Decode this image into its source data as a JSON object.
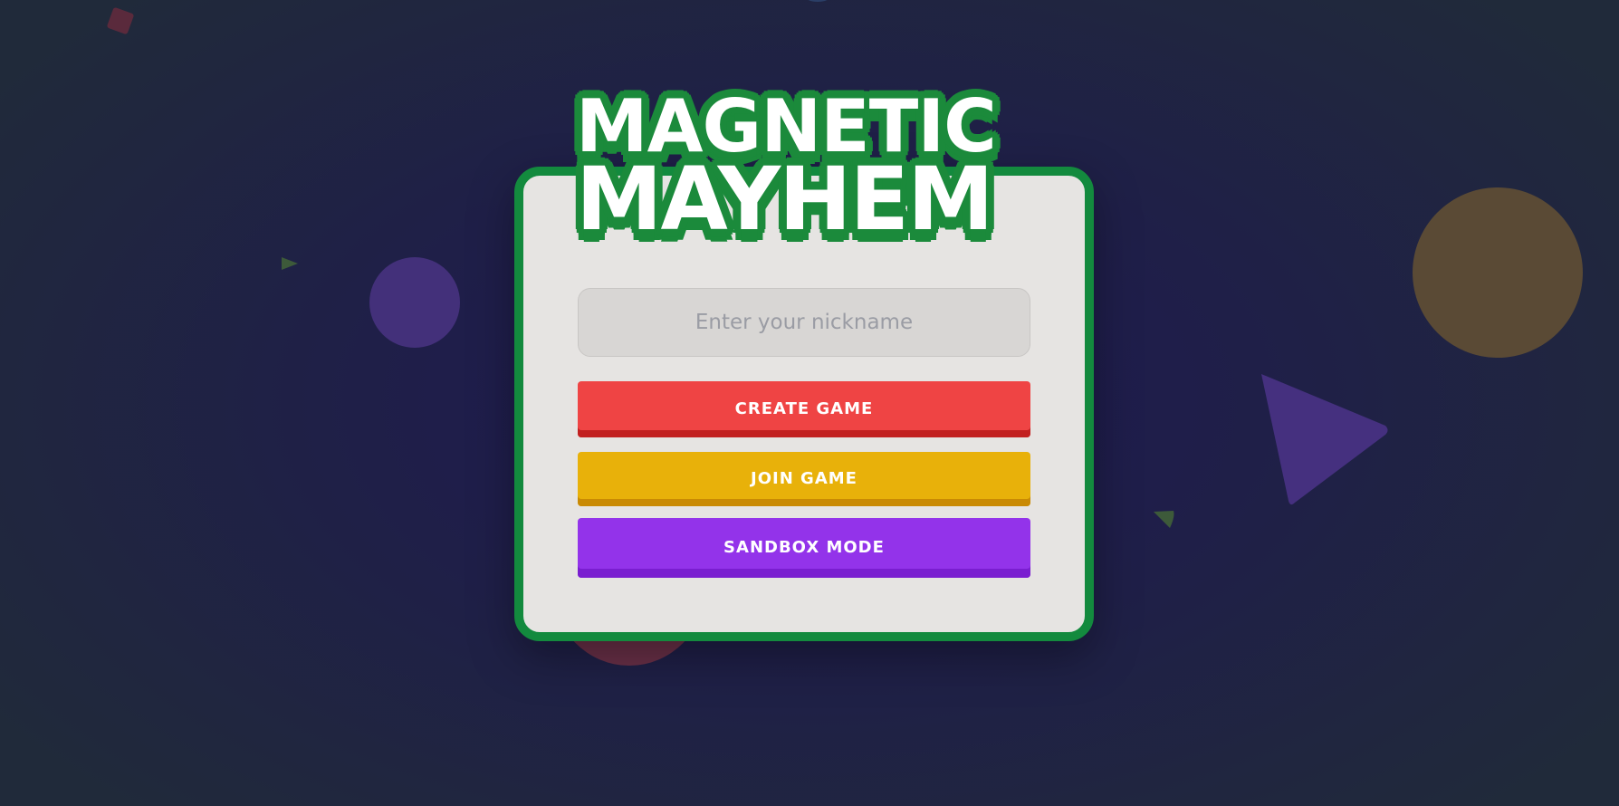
{
  "logo": {
    "line1": "MAGNETIC",
    "line2": "MAYHEM"
  },
  "nickname": {
    "placeholder": "Enter your nickname",
    "value": ""
  },
  "buttons": {
    "create": "CREATE GAME",
    "join": "JOIN GAME",
    "sandbox": "SANDBOX MODE"
  },
  "colors": {
    "card_border": "#138a3e",
    "create": "#ef4444",
    "join": "#e8b10a",
    "sandbox": "#9333ea"
  }
}
